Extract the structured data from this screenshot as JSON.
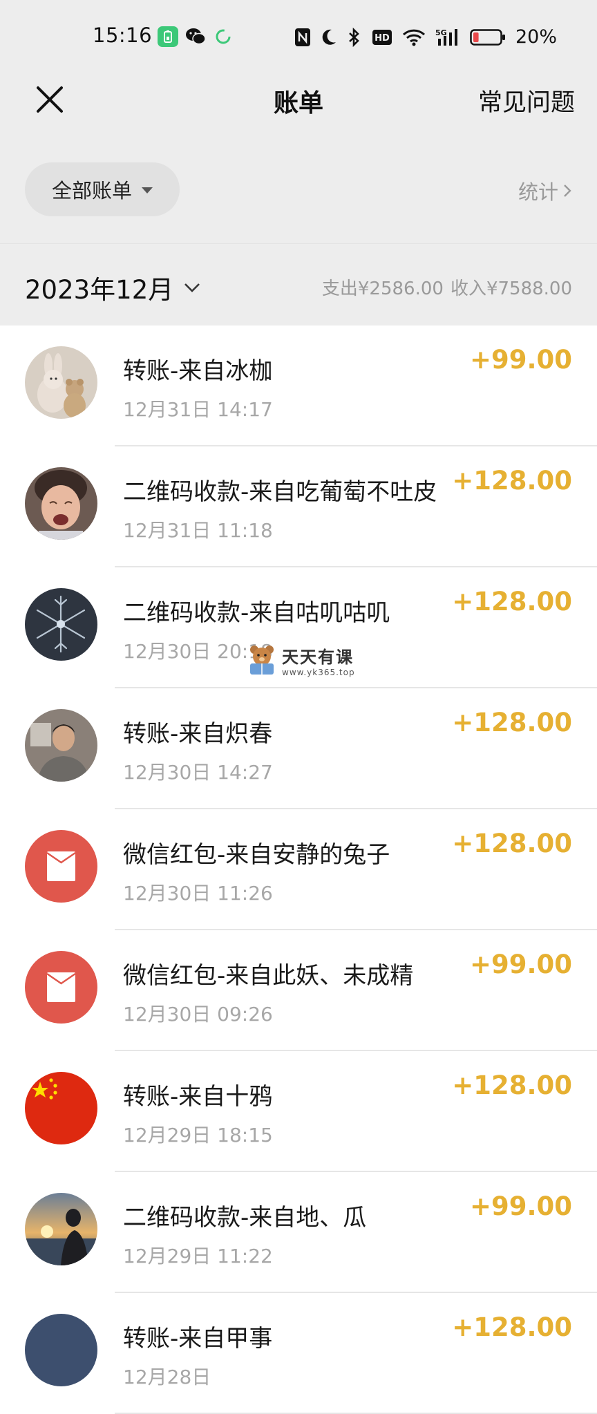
{
  "status_bar": {
    "time": "15:16",
    "battery_percent": "20%",
    "network": "5G",
    "hd_badge": "HD",
    "icons": [
      "battery-saver-icon",
      "wechat-icon",
      "sync-icon",
      "nfc-icon",
      "moon-icon",
      "bluetooth-icon",
      "hd-icon",
      "wifi-icon",
      "signal-icon",
      "battery-icon"
    ],
    "battery_level": 0.2,
    "battery_color": "#e8484a"
  },
  "nav": {
    "title": "账单",
    "faq_label": "常见问题"
  },
  "filter": {
    "label": "全部账单",
    "stats_label": "统计"
  },
  "month": {
    "label": "2023年12月",
    "expense": "支出¥2586.00",
    "income": "收入¥7588.00"
  },
  "colors": {
    "amount": "#e6b032",
    "red_packet": "#e0574c",
    "background": "#ededed"
  },
  "transactions": [
    {
      "title": "转账-来自冰枷",
      "date": "12月31日 14:17",
      "amount": "+99.00",
      "avatar": "plush-toys"
    },
    {
      "title": "二维码收款-来自吃葡萄不吐皮",
      "date": "12月31日 11:18",
      "amount": "+128.00",
      "avatar": "crying-child"
    },
    {
      "title": "二维码收款-来自咕叽咕叽",
      "date": "12月30日 20:18",
      "amount": "+128.00",
      "avatar": "snowflake"
    },
    {
      "title": "转账-来自炽春",
      "date": "12月30日 14:27",
      "amount": "+128.00",
      "avatar": "person"
    },
    {
      "title": "微信红包-来自安静的兔子",
      "date": "12月30日 11:26",
      "amount": "+128.00",
      "avatar": "red-packet"
    },
    {
      "title": "微信红包-来自此妖、未成精",
      "date": "12月30日 09:26",
      "amount": "+99.00",
      "avatar": "red-packet"
    },
    {
      "title": "转账-来自十鸦",
      "date": "12月29日 18:15",
      "amount": "+128.00",
      "avatar": "china-flag"
    },
    {
      "title": "二维码收款-来自地、瓜",
      "date": "12月29日 11:22",
      "amount": "+99.00",
      "avatar": "sunset-person"
    },
    {
      "title": "转账-来自甲事",
      "date": "12月28日",
      "amount": "+128.00",
      "avatar": "partial"
    }
  ],
  "watermark": {
    "title": "天天有课",
    "url": "www.yk365.top"
  }
}
